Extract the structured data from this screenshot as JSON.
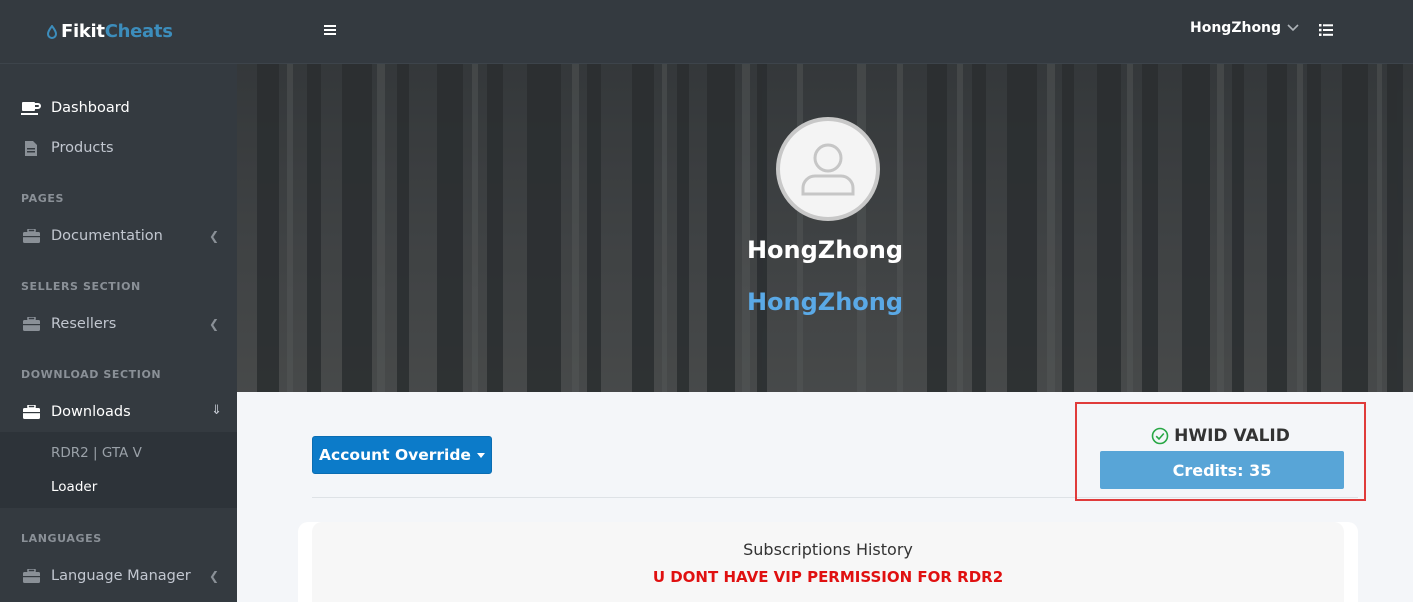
{
  "brand": {
    "part1": "Fikit",
    "part2": "Cheats"
  },
  "sidebar": {
    "items": [
      {
        "label": "Dashboard",
        "icon": "coffee-icon"
      },
      {
        "label": "Products",
        "icon": "file-icon"
      }
    ],
    "sections": [
      {
        "header": "PAGES",
        "item": "Documentation",
        "icon": "briefcase-icon"
      },
      {
        "header": "SELLERS SECTION",
        "item": "Resellers",
        "icon": "briefcase-icon"
      },
      {
        "header": "DOWNLOAD SECTION",
        "item": "Downloads",
        "icon": "briefcase-icon"
      },
      {
        "header": "LANGUAGES",
        "item": "Language Manager",
        "icon": "briefcase-icon"
      }
    ],
    "download_sub": [
      "RDR2 | GTA V",
      "Loader"
    ]
  },
  "topbar": {
    "username": "HongZhong",
    "menu_icon": "hamburger-icon",
    "list_icon": "list-icon"
  },
  "hero": {
    "name": "HongZhong",
    "subtitle": "HongZhong",
    "avatar_icon": "user-icon"
  },
  "content": {
    "override_label": "Account Override",
    "hwid_status": "HWID VALID",
    "credits_label": "Credits: 35",
    "history_title": "Subscriptions History",
    "warning": "U DONT HAVE VIP PERMISSION FOR RDR2"
  },
  "colors": {
    "accent": "#3c8dbc",
    "override": "#0c7bc9",
    "credits": "#58a5d7",
    "warning": "#e01010",
    "valid": "#28a745"
  }
}
